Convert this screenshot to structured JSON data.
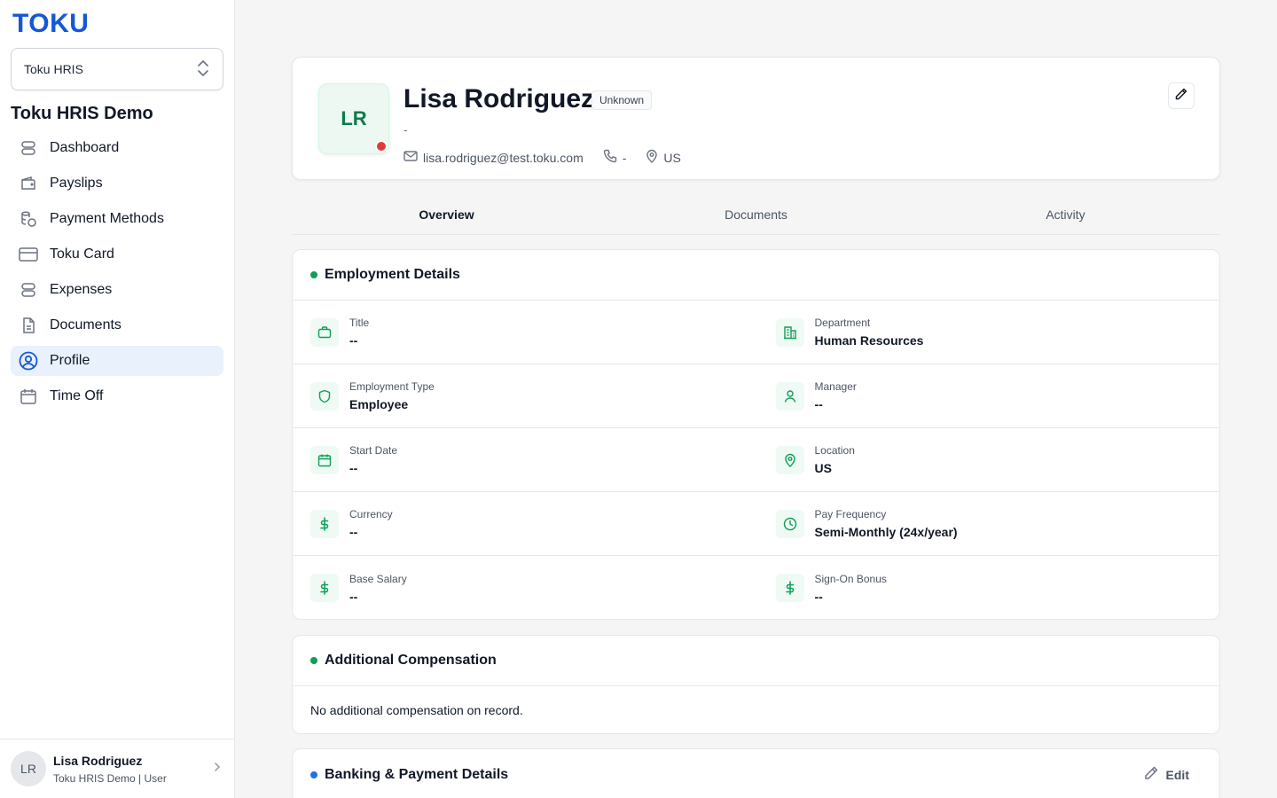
{
  "sidebar": {
    "logo": "TOKU",
    "org_select": "Toku HRIS",
    "org_title": "Toku HRIS Demo",
    "items": [
      {
        "label": "Dashboard",
        "icon": "stack-icon"
      },
      {
        "label": "Payslips",
        "icon": "wallet-icon"
      },
      {
        "label": "Payment Methods",
        "icon": "coins-icon"
      },
      {
        "label": "Toku Card",
        "icon": "credit-card-icon"
      },
      {
        "label": "Expenses",
        "icon": "stack-icon"
      },
      {
        "label": "Documents",
        "icon": "document-icon"
      },
      {
        "label": "Profile",
        "icon": "user-circle-icon"
      },
      {
        "label": "Time Off",
        "icon": "calendar-icon"
      }
    ],
    "active_item": "Profile",
    "user": {
      "initials": "LR",
      "name": "Lisa Rodriguez",
      "sub": "Toku HRIS Demo | User"
    }
  },
  "profile": {
    "initials": "LR",
    "name": "Lisa Rodriguez",
    "badge": "Unknown",
    "subtitle": "-",
    "email": "lisa.rodriguez@test.toku.com",
    "phone": "-",
    "location": "US",
    "status_color": "#e03b3b"
  },
  "tabs": [
    "Overview",
    "Documents",
    "Activity"
  ],
  "active_tab": "Overview",
  "employment": {
    "title": "Employment Details",
    "rows": [
      [
        {
          "label": "Title",
          "value": "--",
          "icon": "briefcase-icon"
        },
        {
          "label": "Department",
          "value": "Human Resources",
          "icon": "building-icon"
        }
      ],
      [
        {
          "label": "Employment Type",
          "value": "Employee",
          "icon": "shield-icon"
        },
        {
          "label": "Manager",
          "value": "--",
          "icon": "user-icon"
        }
      ],
      [
        {
          "label": "Start Date",
          "value": "--",
          "icon": "calendar-icon"
        },
        {
          "label": "Location",
          "value": "US",
          "icon": "map-pin-icon"
        }
      ],
      [
        {
          "label": "Currency",
          "value": "--",
          "icon": "dollar-icon"
        },
        {
          "label": "Pay Frequency",
          "value": "Semi-Monthly (24x/year)",
          "icon": "clock-icon"
        }
      ],
      [
        {
          "label": "Base Salary",
          "value": "--",
          "icon": "dollar-icon"
        },
        {
          "label": "Sign-On Bonus",
          "value": "--",
          "icon": "dollar-icon"
        }
      ]
    ]
  },
  "additional": {
    "title": "Additional Compensation",
    "empty": "No additional compensation on record."
  },
  "banking": {
    "title": "Banking & Payment Details",
    "edit_label": "Edit"
  },
  "colors": {
    "accent": "#1558d6",
    "green": "#0f9d58",
    "blue_dot": "#1a73e8"
  }
}
